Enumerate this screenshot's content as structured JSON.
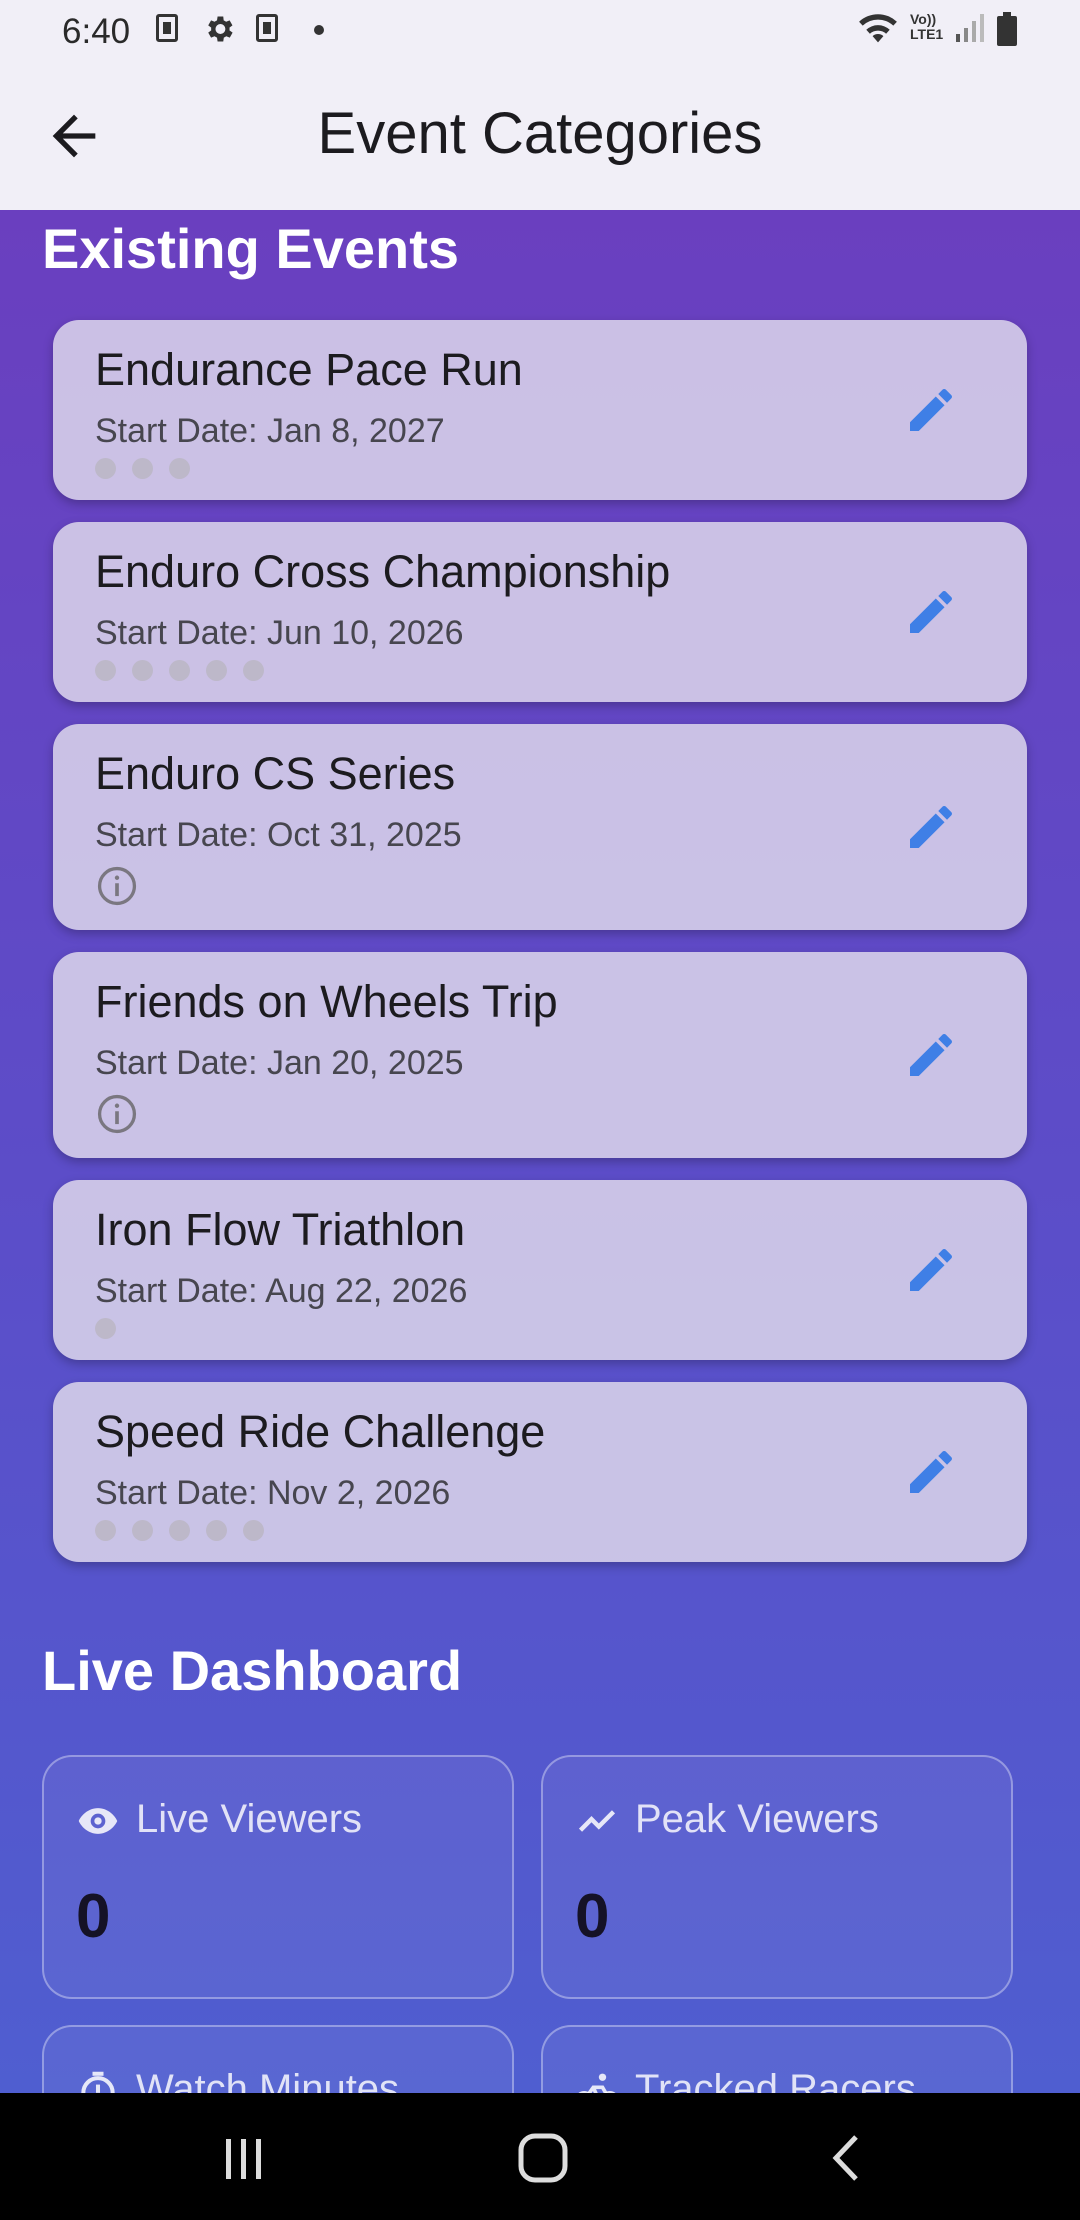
{
  "status_bar": {
    "time": "6:40",
    "icons": [
      "k-box-icon",
      "gear-icon",
      "k-box-icon",
      "dot-icon",
      "wifi-icon",
      "volte-icon",
      "signal-icon",
      "battery-icon"
    ],
    "volte_top": "Vo))",
    "volte_bottom": "LTE1"
  },
  "app_bar": {
    "title": "Event Categories",
    "back_icon": "arrow-back-icon"
  },
  "existing_events": {
    "heading": "Existing Events",
    "items": [
      {
        "name": "Endurance Pace Run",
        "date": "Start Date: Jan 8, 2027",
        "dots": 3,
        "indicator": "dots"
      },
      {
        "name": "Enduro Cross Championship",
        "date": "Start Date: Jun 10, 2026",
        "dots": 5,
        "indicator": "dots"
      },
      {
        "name": "Enduro CS Series",
        "date": "Start Date: Oct 31, 2025",
        "dots": 0,
        "indicator": "info-icon"
      },
      {
        "name": "Friends on Wheels Trip",
        "date": "Start Date: Jan 20, 2025",
        "dots": 0,
        "indicator": "info-icon"
      },
      {
        "name": "Iron Flow Triathlon",
        "date": "Start Date: Aug 22, 2026",
        "dots": 1,
        "indicator": "dots"
      },
      {
        "name": "Speed Ride Challenge",
        "date": "Start Date: Nov 2, 2026",
        "dots": 5,
        "indicator": "dots"
      }
    ],
    "edit_icon": "pencil-edit-icon"
  },
  "live_dashboard": {
    "heading": "Live Dashboard",
    "stats": [
      {
        "label": "Live Viewers",
        "value": "0",
        "icon": "eye-icon"
      },
      {
        "label": "Peak Viewers",
        "value": "0",
        "icon": "trending-up-icon"
      },
      {
        "label": "Watch Minutes",
        "value": "",
        "icon": "timer-icon"
      },
      {
        "label": "Tracked Racers",
        "value": "",
        "icon": "bike-icon"
      }
    ]
  },
  "colors": {
    "accent_edit": "#3f7fe6",
    "purple_top": "#6a3fbf",
    "purple_bottom": "#4f5ed0"
  },
  "nav_bar": {
    "icons": [
      "recent-apps-icon",
      "home-icon",
      "back-icon"
    ]
  }
}
